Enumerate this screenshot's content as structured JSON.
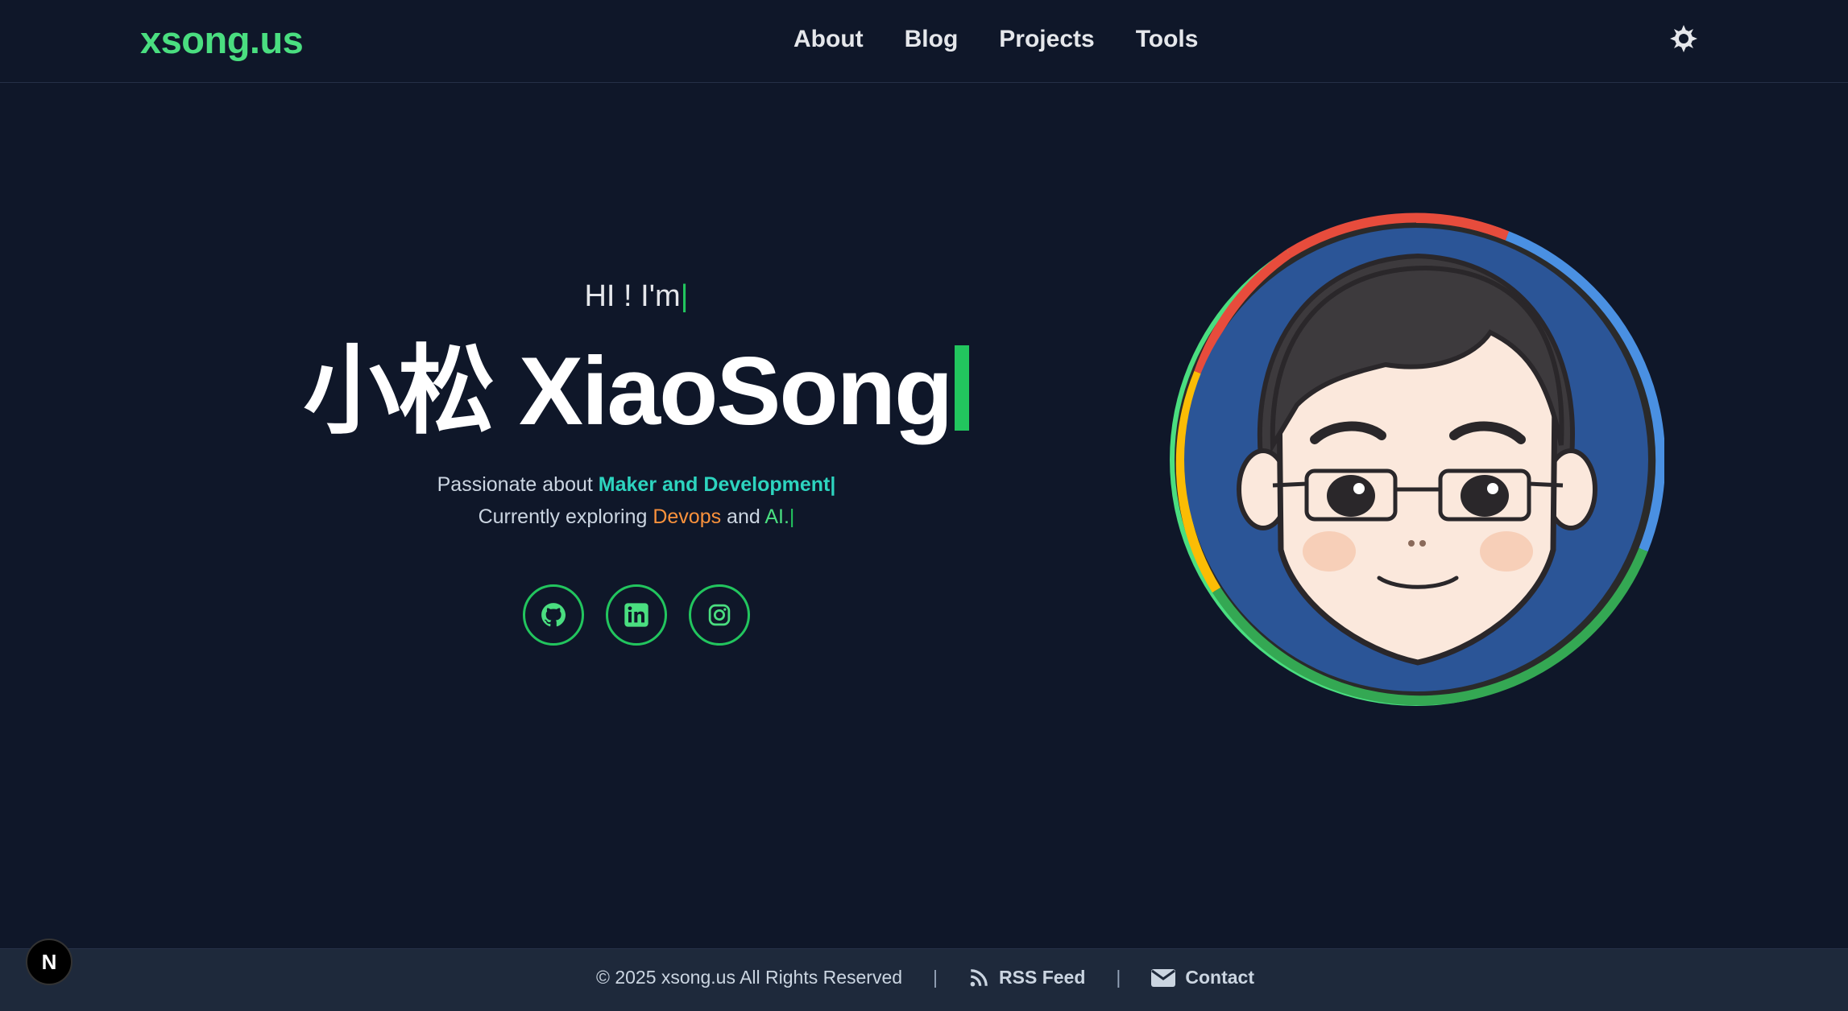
{
  "header": {
    "logo": "xsong.us",
    "nav": [
      "About",
      "Blog",
      "Projects",
      "Tools"
    ],
    "theme_icon": "sun-icon"
  },
  "hero": {
    "greeting": "HI ! I'm",
    "name": "小松 XiaoSong",
    "tagline_1_prefix": "Passionate about ",
    "tagline_1_highlight": "Maker and Development",
    "tagline_2_prefix": "Currently exploring ",
    "tagline_2_devops": "Devops",
    "tagline_2_mid": " and ",
    "tagline_2_ai": "AI.",
    "cursor": "|",
    "socials": [
      "github-icon",
      "linkedin-icon",
      "instagram-icon"
    ]
  },
  "footer": {
    "copyright": "© 2025 xsong.us All Rights Reserved",
    "separator": "|",
    "rss": "RSS Feed",
    "contact": "Contact"
  },
  "badge": {
    "label": "N"
  },
  "colors": {
    "background": "#0f1729",
    "accent": "#22c55e",
    "teal": "#2dd4bf",
    "orange": "#fb923c"
  }
}
